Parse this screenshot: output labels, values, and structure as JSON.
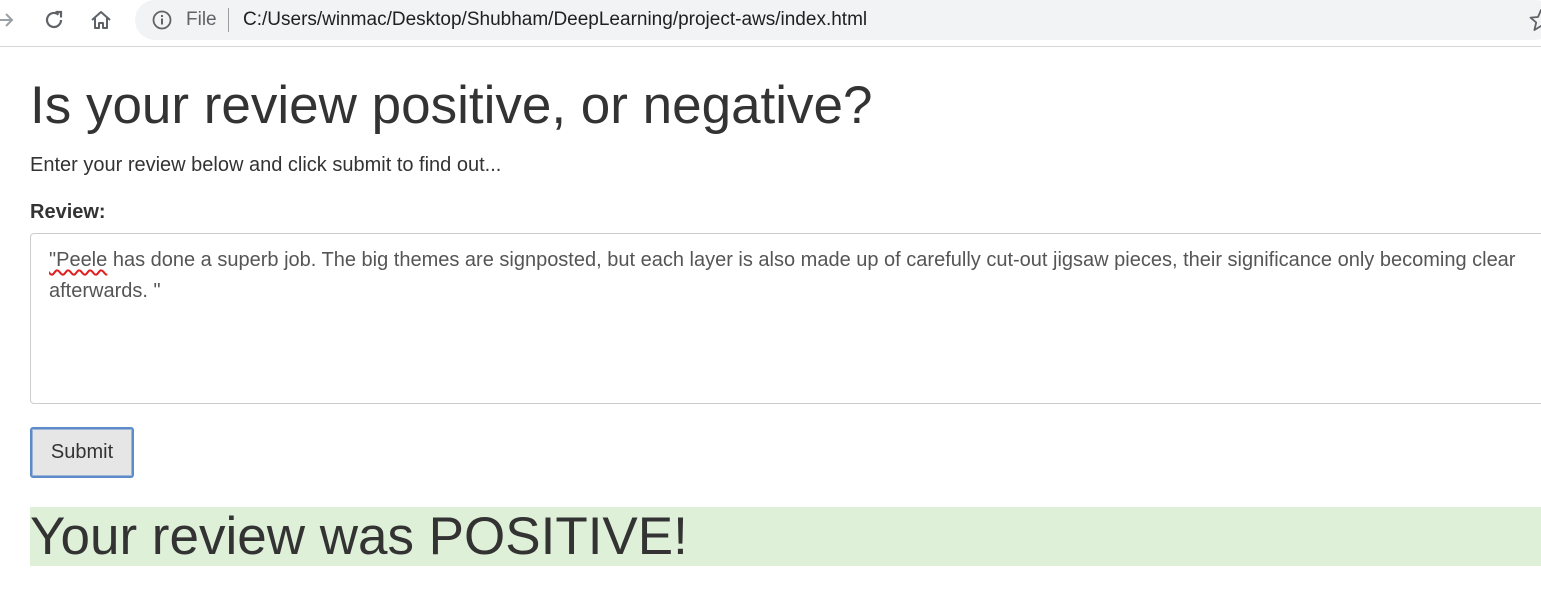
{
  "browser": {
    "scheme_label": "File",
    "url": "C:/Users/winmac/Desktop/Shubham/DeepLearning/project-aws/index.html"
  },
  "page": {
    "title": "Is your review positive, or negative?",
    "intro": "Enter your review below and click submit to find out...",
    "review_label": "Review:",
    "review_text_first_word": "\"Peele",
    "review_text_rest": " has done a superb job. The big themes are signposted, but each layer is also made up of carefully cut-out jigsaw pieces, their significance only becoming clear afterwards. \"",
    "submit_label": "Submit",
    "result": "Your review was POSITIVE!"
  },
  "colors": {
    "result_background": "#dff0d8",
    "text": "#333333",
    "button_focus": "#5b8bc9"
  },
  "icons": [
    "forward-arrow-icon",
    "reload-icon",
    "home-icon",
    "info-icon",
    "bookmark-star-icon"
  ]
}
